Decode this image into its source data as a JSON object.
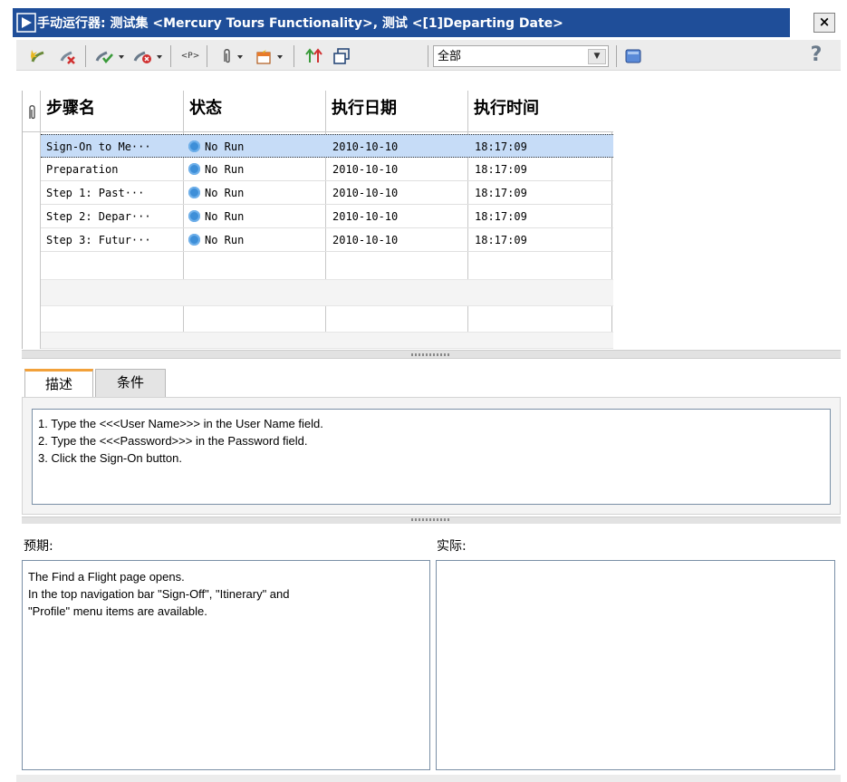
{
  "window": {
    "title": "手动运行器: 测试集 <Mercury Tours Functionality>, 测试 <[1]Departing Date>",
    "close_label": "×"
  },
  "toolbar": {
    "buttons": [
      {
        "name": "new-run-button",
        "icon": "new-step-icon"
      },
      {
        "name": "delete-button",
        "icon": "delete-icon"
      },
      {
        "name": "pass-selected-button",
        "icon": "pass-icon"
      },
      {
        "name": "fail-selected-button",
        "icon": "fail-icon"
      },
      {
        "name": "parameters-button",
        "icon": "parameters-icon",
        "label": "<P>"
      },
      {
        "name": "attachments-button",
        "icon": "paperclip-icon"
      },
      {
        "name": "add-defect-button",
        "icon": "defect-icon"
      },
      {
        "name": "move-step-button",
        "icon": "sort-arrows-icon"
      },
      {
        "name": "restore-window-button",
        "icon": "restore-icon"
      },
      {
        "name": "layout-button",
        "icon": "layout-icon"
      },
      {
        "name": "help-button",
        "icon": "help-icon"
      }
    ],
    "filter": {
      "selected": "全部"
    }
  },
  "grid": {
    "columns": [
      "步骤名",
      "状态",
      "执行日期",
      "执行时间"
    ],
    "rows": [
      {
        "name": "Sign-On to Me···",
        "status": "No Run",
        "date": "2010-10-10",
        "time": "18:17:09"
      },
      {
        "name": "Preparation",
        "status": "No Run",
        "date": "2010-10-10",
        "time": "18:17:09"
      },
      {
        "name": "Step 1: Past···",
        "status": "No Run",
        "date": "2010-10-10",
        "time": "18:17:09"
      },
      {
        "name": "Step 2: Depar···",
        "status": "No Run",
        "date": "2010-10-10",
        "time": "18:17:09"
      },
      {
        "name": "Step 3: Futur···",
        "status": "No Run",
        "date": "2010-10-10",
        "time": "18:17:09"
      }
    ],
    "selected_row": 0
  },
  "tabs": [
    {
      "label": "描述",
      "active": true
    },
    {
      "label": "条件",
      "active": false
    }
  ],
  "description": {
    "lines": [
      "1. Type the <<<User Name>>> in the User Name field.",
      "2. Type the <<<Password>>> in the Password field.",
      "3. Click the Sign-On button."
    ]
  },
  "expected": {
    "label": "预期:",
    "lines": [
      "The Find a Flight page opens.",
      "In the top navigation bar \"Sign-Off\", \"Itinerary\" and",
      "\"Profile\" menu items are available."
    ]
  },
  "actual": {
    "label": "实际:",
    "text": ""
  },
  "colors": {
    "title_bar": "#1f4e99",
    "selected_row": "#c6dcf7",
    "active_tab_accent": "#f2a13a",
    "status_icon": "#3e8fd8"
  }
}
